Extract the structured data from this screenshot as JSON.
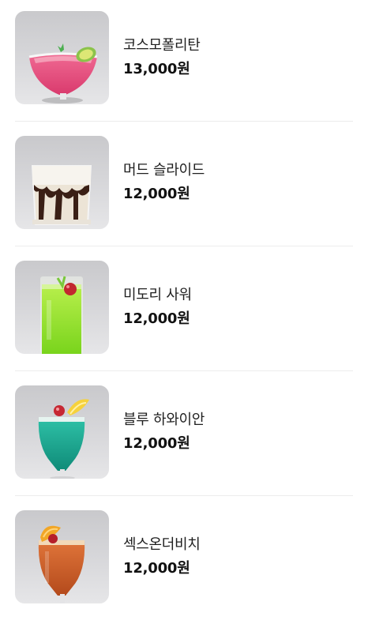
{
  "menu": {
    "items": [
      {
        "name": "코스모폴리탄",
        "price": "13,000원",
        "photo": "cosmopolitan-drink-photo",
        "liquid_color": "#e0457a"
      },
      {
        "name": "머드 슬라이드",
        "price": "12,000원",
        "photo": "mudslide-drink-photo",
        "liquid_color": "#e9dfcf"
      },
      {
        "name": "미도리 사워",
        "price": "12,000원",
        "photo": "midori-sour-drink-photo",
        "liquid_color": "#8ee02a"
      },
      {
        "name": "블루 하와이안",
        "price": "12,000원",
        "photo": "blue-hawaiian-drink-photo",
        "liquid_color": "#1aa58f"
      },
      {
        "name": "섹스온더비치",
        "price": "12,000원",
        "photo": "sex-on-the-beach-drink-photo",
        "liquid_color": "#d9672a"
      }
    ]
  }
}
